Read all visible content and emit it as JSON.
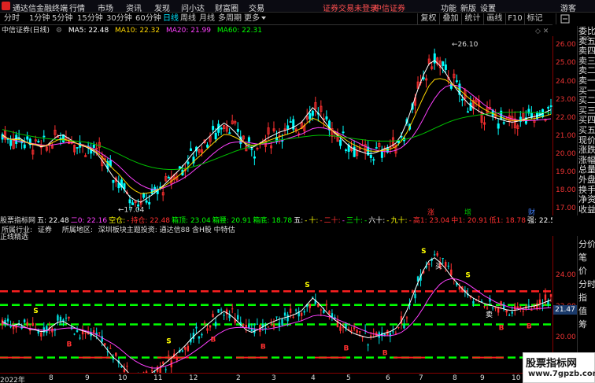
{
  "app": {
    "title": "通达信金融终端",
    "menus": [
      "行情",
      "市场",
      "资讯",
      "发现",
      "问小达",
      "财富圈",
      "交易"
    ],
    "notice": "证券交易未登录",
    "broker": "中信证券",
    "top_right_menus": [
      "功能",
      "新版",
      "设置",
      "游客"
    ]
  },
  "periods": {
    "items": [
      "分时",
      "1分钟",
      "5分钟",
      "15分钟",
      "30分钟",
      "60分钟",
      "日线",
      "周线",
      "月线",
      "多周期",
      "更多"
    ],
    "active_index": 6
  },
  "toolbar_right": [
    "复权",
    "叠加",
    "统计",
    "画线",
    "F10",
    "标记"
  ],
  "ma_bar": {
    "stock": "中信证券(日线)",
    "items": [
      {
        "label": "MA5: 22.48",
        "color": "#ffffff"
      },
      {
        "label": "MA10: 22.32",
        "color": "#ffd700"
      },
      {
        "label": "MA20: 21.99",
        "color": "#ff40ff"
      },
      {
        "label": "MA60: 22.31",
        "color": "#00ff00"
      }
    ]
  },
  "main_axis": {
    "ticks": [
      "26.00",
      "25.00",
      "24.00",
      "23.00",
      "22.00",
      "21.00",
      "20.00",
      "19.00",
      "18.00",
      "17.00"
    ],
    "min": 16.8,
    "max": 26.4
  },
  "price_labels": {
    "high": "26.10",
    "low": "17.04"
  },
  "markers": [
    {
      "text": "涨",
      "color": "#ff3030"
    },
    {
      "text": "增",
      "color": "#00c000"
    },
    {
      "text": "财",
      "color": "#4080ff"
    }
  ],
  "order_book": [
    "委比",
    "卖五",
    "卖四",
    "卖三",
    "卖二",
    "卖一",
    "买一",
    "买二",
    "买三",
    "买四",
    "买五",
    "现价",
    "涨跌",
    "涨幅",
    "总量",
    "外盘",
    "换手",
    "净资",
    "收益"
  ],
  "order_book_num": "300",
  "indicator_bar": {
    "items": [
      {
        "t": "股票指标网",
        "c": "#ddd"
      },
      {
        "t": "五: 22.48",
        "c": "#ffffff"
      },
      {
        "t": "二0: 22.16",
        "c": "#ff40ff"
      },
      {
        "t": "空仓:",
        "c": "#ffff00"
      },
      {
        "t": "-",
        "c": "#ff3030"
      },
      {
        "t": "持仓: 22.48",
        "c": "#ff3030"
      },
      {
        "t": "箱顶: 23.04",
        "c": "#00ff00"
      },
      {
        "t": "箱腰: 20.91",
        "c": "#00ff00"
      },
      {
        "t": "箱底: 18.78",
        "c": "#00ff00"
      },
      {
        "t": "五:",
        "c": "#ffffff"
      },
      {
        "t": "-",
        "c": "#ffff00"
      },
      {
        "t": "十:",
        "c": "#ffff00"
      },
      {
        "t": "-",
        "c": "#ff3030"
      },
      {
        "t": "二十:",
        "c": "#ff3030"
      },
      {
        "t": "-",
        "c": "#ff40ff"
      },
      {
        "t": "三十:",
        "c": "#00ff00"
      },
      {
        "t": "-",
        "c": "#00ff00"
      },
      {
        "t": "六十:",
        "c": "#ffffff"
      },
      {
        "t": "-",
        "c": "#ffff00"
      },
      {
        "t": "九十:",
        "c": "#ffff00"
      },
      {
        "t": "-",
        "c": "#ff3030"
      },
      {
        "t": "高1: 23.04",
        "c": "#ff3030"
      },
      {
        "t": "中1: 20.91",
        "c": "#ff3030"
      },
      {
        "t": "低1: 18.78",
        "c": "#ff3030"
      },
      {
        "t": "强: 22.59",
        "c": "#ffffff"
      },
      {
        "t": "弱: 22.43",
        "c": "#4080ff"
      },
      {
        "t": "撑: 22.16",
        "c": "#ffffff"
      },
      {
        "t": "底",
        "c": "#ffff00"
      }
    ]
  },
  "info_bar": {
    "industry_label": "所属行业:",
    "industry": "证券",
    "region_label": "所属地区:",
    "region": "深圳板块主题投资: 通达信88 含H股 中特估",
    "sub_label": "正线精选"
  },
  "sub_axis": {
    "ticks": [
      "24.00",
      "22.00",
      "20.00"
    ],
    "min": 18.0,
    "max": 26.4
  },
  "current_price": "21.47",
  "sub_labels": {
    "buy": "买",
    "sell": "卖"
  },
  "sub_right_panel": [
    "分价",
    "笔",
    "价",
    "分时",
    "指",
    "值",
    "筹"
  ],
  "dates": [
    "2022年",
    "8",
    "9",
    "10",
    "11",
    "12",
    "2",
    "3",
    "4",
    "5",
    "6",
    "7",
    "8",
    "9",
    "10"
  ],
  "watermark": {
    "line1": "股票指标网",
    "line2": "www.7gpzb.com"
  },
  "colors": {
    "up": "#ff3030",
    "down": "#00ffff",
    "ma5": "#ffffff",
    "ma10": "#ffd700",
    "ma20": "#ff40ff",
    "ma60": "#00c000",
    "box": "#00ff00",
    "boxred": "#ff2020"
  },
  "chart_data": {
    "type": "line",
    "series": [
      {
        "name": "MA5",
        "values": [
          21.1,
          20.9,
          20.85,
          20.95,
          20.75,
          20.6,
          20.55,
          20.45,
          20.5,
          20.8,
          21.05,
          21.1,
          20.9,
          20.7,
          20.55,
          20.45,
          20.3,
          20.1,
          19.7,
          19.25,
          18.8,
          18.5,
          18.1,
          17.7,
          17.5,
          17.4,
          17.6,
          17.8,
          18.05,
          18.3,
          18.6,
          18.9,
          19.2,
          19.55,
          19.95,
          20.3,
          20.6,
          20.9,
          21.2,
          21.5,
          21.75,
          21.55,
          21.25,
          20.9,
          20.55,
          20.4,
          20.55,
          20.75,
          20.95,
          21.1,
          21.25,
          21.35,
          21.45,
          21.6,
          21.8,
          22.2,
          22.6,
          22.3,
          21.9,
          21.5,
          21.2,
          20.95,
          20.65,
          20.4,
          20.25,
          20.15,
          20.05,
          20.1,
          20.2,
          20.35,
          20.45,
          20.65,
          21.1,
          21.8,
          22.7,
          23.6,
          24.4,
          25.0,
          25.2,
          24.9,
          24.5,
          24.0,
          23.6,
          23.2,
          22.85,
          22.6,
          22.4,
          22.25,
          22.15,
          22.05,
          21.95,
          21.85,
          21.8,
          21.85,
          21.95,
          22.05,
          22.1,
          22.2,
          22.35,
          22.48
        ]
      },
      {
        "name": "MA20",
        "values": [
          21.0,
          20.9,
          20.82,
          20.75,
          20.7,
          20.65,
          20.6,
          20.55,
          20.52,
          20.55,
          20.6,
          20.65,
          20.68,
          20.66,
          20.6,
          20.5,
          20.4,
          20.25,
          20.05,
          19.85,
          19.65,
          19.4,
          19.1,
          18.8,
          18.55,
          18.35,
          18.2,
          18.1,
          18.1,
          18.18,
          18.3,
          18.45,
          18.6,
          18.78,
          19.0,
          19.25,
          19.5,
          19.78,
          20.05,
          20.3,
          20.5,
          20.65,
          20.7,
          20.72,
          20.7,
          20.65,
          20.6,
          20.6,
          20.62,
          20.68,
          20.75,
          20.85,
          20.95,
          21.05,
          21.15,
          21.3,
          21.45,
          21.5,
          21.48,
          21.4,
          21.3,
          21.15,
          21.0,
          20.85,
          20.7,
          20.55,
          20.4,
          20.3,
          20.22,
          20.18,
          20.18,
          20.25,
          20.4,
          20.65,
          21.0,
          21.45,
          22.0,
          22.6,
          23.1,
          23.5,
          23.75,
          23.85,
          23.82,
          23.7,
          23.5,
          23.25,
          23.0,
          22.75,
          22.55,
          22.35,
          22.2,
          22.08,
          21.98,
          21.92,
          21.88,
          21.88,
          21.9,
          21.93,
          21.96,
          21.99
        ]
      },
      {
        "name": "MA60",
        "values": [
          21.4,
          21.32,
          21.24,
          21.16,
          21.1,
          21.04,
          20.98,
          20.94,
          20.9,
          20.87,
          20.84,
          20.82,
          20.8,
          20.77,
          20.74,
          20.7,
          20.64,
          20.56,
          20.46,
          20.34,
          20.2,
          20.05,
          19.9,
          19.75,
          19.62,
          19.5,
          19.4,
          19.32,
          19.26,
          19.22,
          19.2,
          19.2,
          19.22,
          19.26,
          19.32,
          19.4,
          19.5,
          19.6,
          19.72,
          19.84,
          19.96,
          20.08,
          20.2,
          20.3,
          20.4,
          20.48,
          20.56,
          20.64,
          20.7,
          20.76,
          20.82,
          20.86,
          20.9,
          20.94,
          20.98,
          21.02,
          21.06,
          21.08,
          21.08,
          21.06,
          21.04,
          21.0,
          20.96,
          20.92,
          20.88,
          20.84,
          20.8,
          20.78,
          20.76,
          20.76,
          20.76,
          20.78,
          20.82,
          20.88,
          20.96,
          21.06,
          21.18,
          21.32,
          21.46,
          21.6,
          21.74,
          21.86,
          21.96,
          22.04,
          22.1,
          22.15,
          22.2,
          22.24,
          22.27,
          22.3,
          22.32,
          22.34,
          22.35,
          22.36,
          22.35,
          22.34,
          22.33,
          22.32,
          22.31,
          22.31
        ]
      }
    ]
  }
}
